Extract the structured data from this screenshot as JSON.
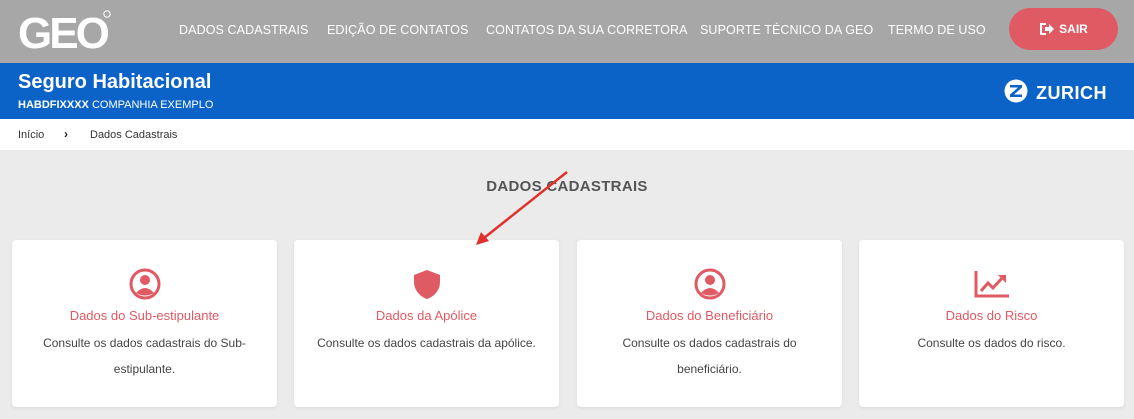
{
  "topbar": {
    "logo_text": "GEO",
    "nav": [
      {
        "label": "DADOS CADASTRAIS"
      },
      {
        "label": "EDIÇÃO DE CONTATOS"
      },
      {
        "label": "CONTATOS DA SUA CORRETORA"
      },
      {
        "label": "SUPORTE TÉCNICO DA GEO"
      },
      {
        "label": "TERMO DE USO"
      }
    ],
    "logout_label": "SAIR",
    "logout_icon": "sign-out-icon"
  },
  "header": {
    "title": "Seguro Habitacional",
    "policy_code": "HABDFIXXXX",
    "company": "COMPANHIA EXEMPLO",
    "brand": "ZURICH"
  },
  "breadcrumb": {
    "home": "Início",
    "current": "Dados Cadastrais"
  },
  "main": {
    "title": "DADOS CADASTRAIS",
    "cards": [
      {
        "title": "Dados do Sub-estipulante",
        "description": "Consulte os dados cadastrais do Sub-estipulante.",
        "icon": "user-circle-icon"
      },
      {
        "title": "Dados da Apólice",
        "description": "Consulte os dados cadastrais da apólice.",
        "icon": "shield-icon"
      },
      {
        "title": "Dados do Beneficiário",
        "description": "Consulte os dados cadastrais do beneficiário.",
        "icon": "user-circle-icon"
      },
      {
        "title": "Dados do Risco",
        "description": "Consulte os dados do risco.",
        "icon": "trend-chart-icon"
      }
    ]
  },
  "colors": {
    "topbar": "#a7a7a7",
    "header": "#0c63c7",
    "accent": "#e05a63",
    "background": "#ebebeb",
    "annotation_arrow": "#e0312b"
  }
}
